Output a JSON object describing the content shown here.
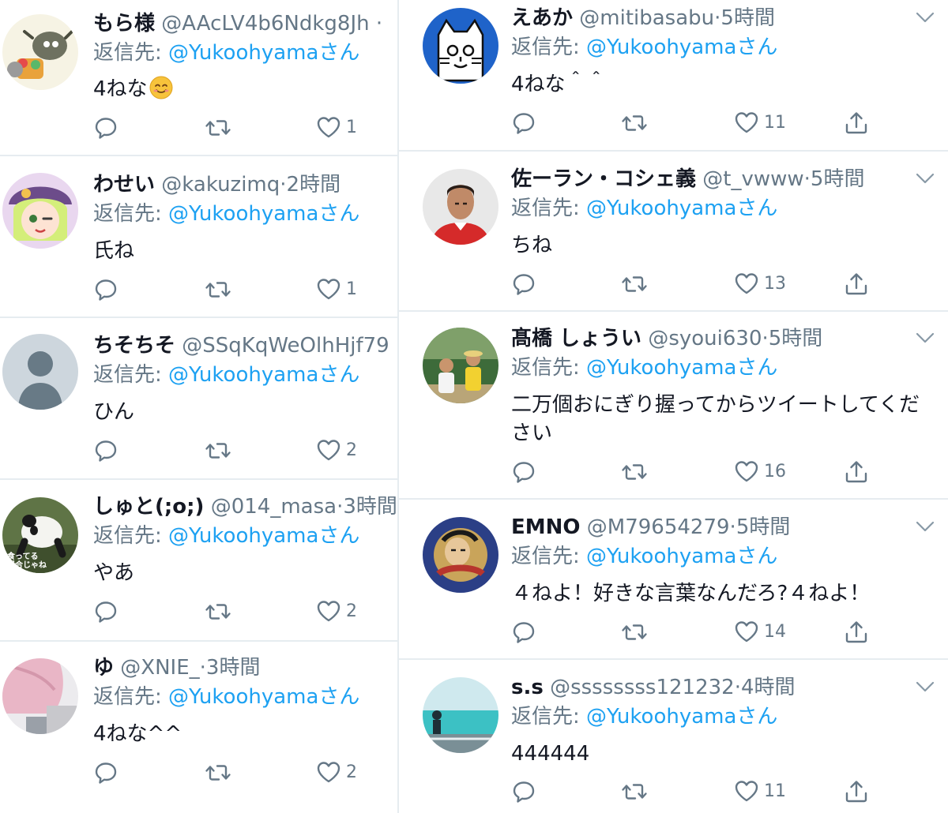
{
  "left_column": [
    {
      "name": "もら様",
      "handle": "@AAcLV4b6Ndkg8Jh",
      "dot": "·",
      "time": "",
      "reply_prefix": "返信先: ",
      "reply_mention": "@Yukoohyamaさん",
      "text": "4ねな",
      "emoji": "smiling-face-emoji",
      "likes": "1",
      "avatar": "anime-creature-avatar"
    },
    {
      "name": "わせい",
      "handle": "@kakuzimq",
      "dot": "·",
      "time": "2時間",
      "reply_prefix": "返信先: ",
      "reply_mention": "@Yukoohyamaさん",
      "text": "氏ね",
      "likes": "1",
      "avatar": "anime-girl-avatar"
    },
    {
      "name": "ちそちそ",
      "handle": "@SSqKqWeOlhHjf79",
      "dot": "",
      "time": "",
      "reply_prefix": "返信先: ",
      "reply_mention": "@Yukoohyamaさん",
      "text": "ひん",
      "likes": "2",
      "avatar": "default-avatar"
    },
    {
      "name": "しゅと(;o;)",
      "handle": "@014_masa",
      "dot": "·",
      "time": "3時間",
      "reply_prefix": "返信先: ",
      "reply_mention": "@Yukoohyamaさん",
      "text": "やあ",
      "likes": "2",
      "avatar": "panda-avatar",
      "avatar_caption_1": "食ってる",
      "avatar_caption_2": "場合じゃね"
    },
    {
      "name": "ゆ",
      "handle": "@XNIE_",
      "dot": "·",
      "time": "3時間",
      "reply_prefix": "返信先: ",
      "reply_mention": "@Yukoohyamaさん",
      "text": "4ねな^^",
      "likes": "2",
      "avatar": "pink-hair-avatar"
    }
  ],
  "right_column": [
    {
      "name": "えあか",
      "handle": "@mitibasabu",
      "dot": "·",
      "time": "5時間",
      "reply_prefix": "返信先: ",
      "reply_mention": "@Yukoohyamaさん",
      "text": "4ねな＾＾",
      "likes": "11",
      "avatar": "cat-avatar"
    },
    {
      "name": "佐ーラン・コシェ義",
      "handle": "@t_vwww",
      "dot": "·",
      "time": "5時間",
      "reply_prefix": "返信先: ",
      "reply_mention": "@Yukoohyamaさん",
      "text": "ちね",
      "likes": "13",
      "avatar": "football-player-avatar"
    },
    {
      "name": "髙橋 しょうい",
      "handle": "@syoui630",
      "dot": "·",
      "time": "5時間",
      "reply_prefix": "返信先: ",
      "reply_mention": "@Yukoohyamaさん",
      "text_line1": "二万個おにぎり握ってからツイートしてくだ",
      "text_line2": "さい",
      "likes": "16",
      "avatar": "kids-photo-avatar"
    },
    {
      "name": "EMNO",
      "handle": "@M79654279",
      "dot": "·",
      "time": "5時間",
      "reply_prefix": "返信先: ",
      "reply_mention": "@Yukoohyamaさん",
      "text": "４ねよ！好きな言葉なんだろ?４ねよ！",
      "likes": "14",
      "avatar": "ukiyoe-avatar"
    },
    {
      "name": "s.s",
      "handle": "@ssssssss121232",
      "dot": "·",
      "time": "4時間",
      "reply_prefix": "返信先: ",
      "reply_mention": "@Yukoohyamaさん",
      "text": "444444",
      "likes": "11",
      "avatar": "beach-avatar"
    }
  ],
  "colors": {
    "mention": "#1da1f2",
    "muted": "#657786",
    "text": "#141823",
    "separator": "#e6ecf0"
  }
}
